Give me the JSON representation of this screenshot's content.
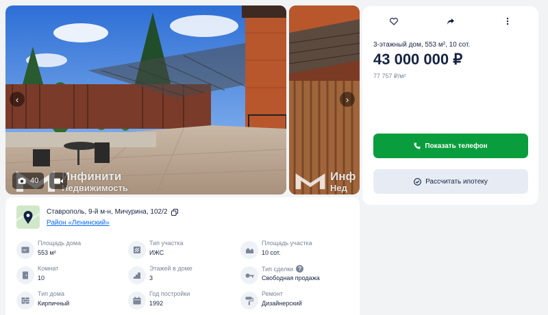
{
  "gallery": {
    "photo_count": "40",
    "watermark": {
      "line1": "Инфинити",
      "line2": "Недвижимость"
    },
    "watermark_side": {
      "line1": "Инф",
      "line2": "Нед"
    }
  },
  "offer": {
    "title": "3-этажный дом, 553 м², 10 сот.",
    "price": "43 000 000 ₽",
    "price_per_m2": "77 757 ₽/м²"
  },
  "buttons": {
    "show_phone": "Показать телефон",
    "mortgage": "Рассчитать ипотеку"
  },
  "location": {
    "address": "Ставрополь, 9-й м-н, Мичурина, 102/2",
    "district": "Район «Ленинский»"
  },
  "params": [
    {
      "label": "Площадь дома",
      "value": "553 м²",
      "icon": "area-icon"
    },
    {
      "label": "Тип участка",
      "value": "ИЖС",
      "icon": "land-type-icon"
    },
    {
      "label": "Площадь участка",
      "value": "10 сот.",
      "icon": "plot-area-icon"
    },
    {
      "label": "Комнат",
      "value": "10",
      "icon": "door-icon"
    },
    {
      "label": "Этажей в доме",
      "value": "3",
      "icon": "stairs-icon"
    },
    {
      "label": "Тип сделки",
      "value": "Свободная продажа",
      "icon": "key-icon"
    },
    {
      "label": "Тип дома",
      "value": "Кирпичный",
      "icon": "brick-icon"
    },
    {
      "label": "Год постройки",
      "value": "1992",
      "icon": "calendar-icon"
    },
    {
      "label": "Ремонт",
      "value": "Дизайнерский",
      "icon": "paint-roller-icon"
    }
  ],
  "colors": {
    "accent_green": "#0a9d3d",
    "link_blue": "#0468ff",
    "text_primary": "#152242",
    "text_secondary": "#7a8599"
  }
}
